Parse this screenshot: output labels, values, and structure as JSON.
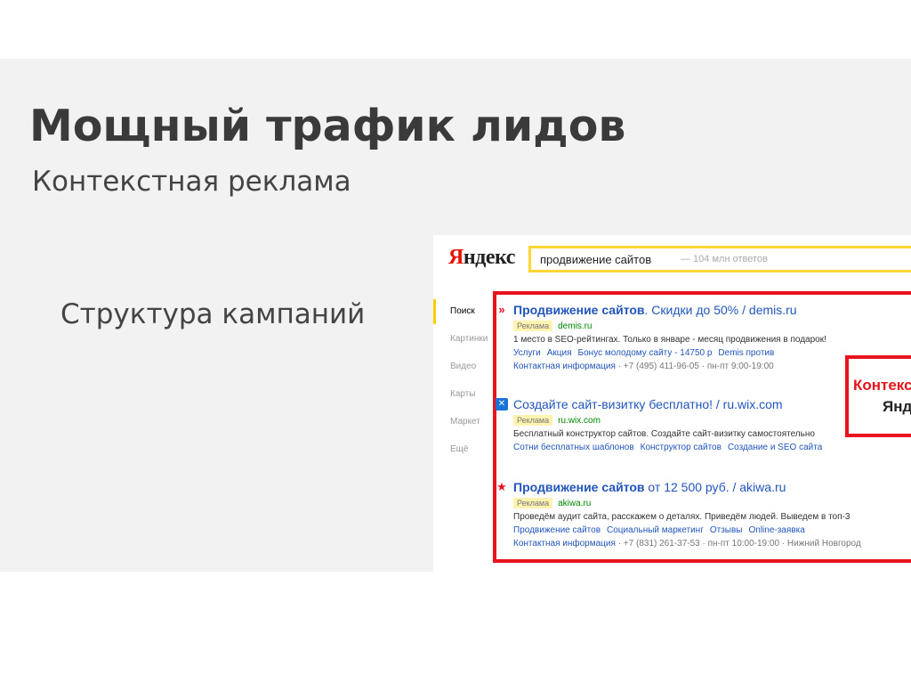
{
  "slide": {
    "title": "Мощный трафик лидов",
    "subtitle": "Контекстная реклама",
    "structure_label": "Структура кампаний"
  },
  "serp": {
    "logo_first": "Я",
    "logo_rest": "ндекс",
    "query": "продвижение сайтов",
    "query_hint": "— 104 млн ответов",
    "nav": [
      "Поиск",
      "Картинки",
      "Видео",
      "Карты",
      "Маркет",
      "Ещё"
    ],
    "ads": [
      {
        "icon": "double-chevron-up-icon",
        "headline_bold": "Продвижение сайтов",
        "headline_rest": ". Скидки до 50% / demis.ru",
        "badge": "Реклама",
        "domain": "demis.ru",
        "desc": "1 место в SEO-рейтингах. Только в январе - месяц продвижения в подарок!",
        "links": [
          "Услуги",
          "Акция",
          "Бонус молодому сайту - 14750 р",
          "Demis против"
        ],
        "contacts": "Контактная информация",
        "contacts_rest": "· +7 (495) 411-96-05 · пн-пт 9:00-19:00"
      },
      {
        "icon": "wix-square-icon",
        "headline_bold": "",
        "headline_rest": "Создайте сайт-визитку бесплатно! / ru.wix.com",
        "badge": "Реклама",
        "domain": "ru.wix.com",
        "desc": "Бесплатный конструктор сайтов. Создайте сайт-визитку самостоятельно",
        "links": [
          "Сотни бесплатных шаблонов",
          "Конструктор сайтов",
          "Создание и SEO сайта"
        ],
        "contacts": "",
        "contacts_rest": ""
      },
      {
        "icon": "red-star-icon",
        "headline_bold": "Продвижение сайтов",
        "headline_rest": " от 12 500 руб. / akiwa.ru",
        "badge": "Реклама",
        "domain": "akiwa.ru",
        "desc": "Проведём аудит сайта, расскажем о деталях. Приведём людей. Выведем в топ-3",
        "links": [
          "Продвижение сайтов",
          "Социальный маркетинг",
          "Отзывы",
          "Online-заявка"
        ],
        "contacts": "Контактная информация",
        "contacts_rest": "· +7 (831) 261-37-53 · пн-пт 10:00-19:00 · Нижний Новгород"
      }
    ],
    "callout_line1": "Контекстная",
    "callout_line2": "Яндекс"
  },
  "colors": {
    "accent_red": "#e8141d",
    "link_blue": "#2255bb",
    "search_border": "#ffd633",
    "slide_bg": "#f2f2f2"
  }
}
